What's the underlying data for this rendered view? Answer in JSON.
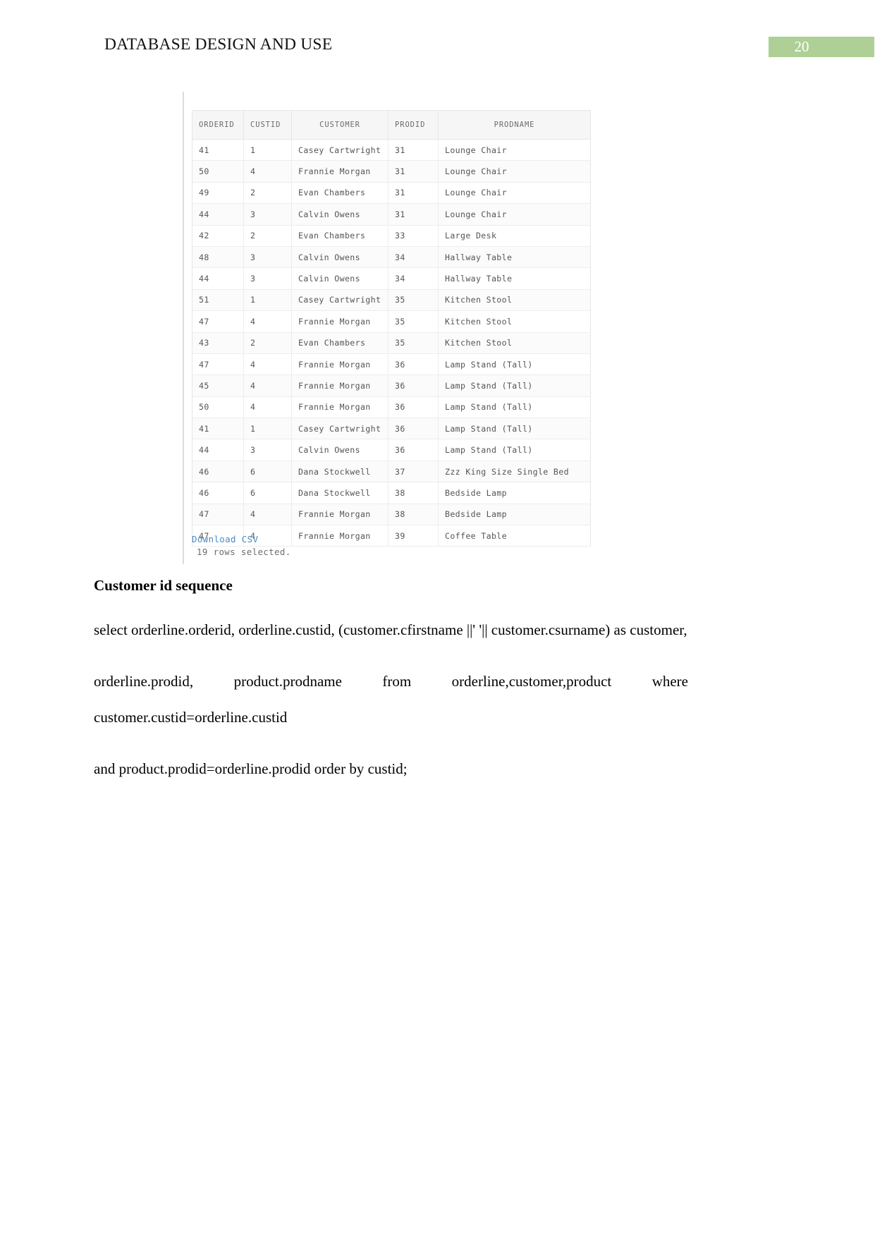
{
  "header": {
    "title": "DATABASE DESIGN AND USE",
    "page_number": "20",
    "badge_color": "#aed096"
  },
  "result_panel": {
    "link_color": "#4b89c4",
    "columns": [
      "ORDERID",
      "CUSTID",
      "CUSTOMER",
      "PRODID",
      "PRODNAME"
    ],
    "rows": [
      [
        "41",
        "1",
        "Casey Cartwright",
        "31",
        "Lounge Chair"
      ],
      [
        "50",
        "4",
        "Frannie Morgan",
        "31",
        "Lounge Chair"
      ],
      [
        "49",
        "2",
        "Evan Chambers",
        "31",
        "Lounge Chair"
      ],
      [
        "44",
        "3",
        "Calvin Owens",
        "31",
        "Lounge Chair"
      ],
      [
        "42",
        "2",
        "Evan Chambers",
        "33",
        "Large Desk"
      ],
      [
        "48",
        "3",
        "Calvin Owens",
        "34",
        "Hallway Table"
      ],
      [
        "44",
        "3",
        "Calvin Owens",
        "34",
        "Hallway Table"
      ],
      [
        "51",
        "1",
        "Casey Cartwright",
        "35",
        "Kitchen Stool"
      ],
      [
        "47",
        "4",
        "Frannie Morgan",
        "35",
        "Kitchen Stool"
      ],
      [
        "43",
        "2",
        "Evan Chambers",
        "35",
        "Kitchen Stool"
      ],
      [
        "47",
        "4",
        "Frannie Morgan",
        "36",
        "Lamp Stand (Tall)"
      ],
      [
        "45",
        "4",
        "Frannie Morgan",
        "36",
        "Lamp Stand (Tall)"
      ],
      [
        "50",
        "4",
        "Frannie Morgan",
        "36",
        "Lamp Stand (Tall)"
      ],
      [
        "41",
        "1",
        "Casey Cartwright",
        "36",
        "Lamp Stand (Tall)"
      ],
      [
        "44",
        "3",
        "Calvin Owens",
        "36",
        "Lamp Stand (Tall)"
      ],
      [
        "46",
        "6",
        "Dana Stockwell",
        "37",
        "Zzz King Size Single Bed"
      ],
      [
        "46",
        "6",
        "Dana Stockwell",
        "38",
        "Bedside Lamp"
      ],
      [
        "47",
        "4",
        "Frannie Morgan",
        "38",
        "Bedside Lamp"
      ],
      [
        "47",
        "4",
        "Frannie Morgan",
        "39",
        "Coffee Table"
      ]
    ],
    "download_link": "Download CSV",
    "rows_selected": "19 rows selected."
  },
  "content": {
    "heading": "Customer id sequence",
    "paragraph_1": "select  orderline.orderid,  orderline.custid,  (customer.cfirstname  ||' '||  customer.csurname)  as customer,",
    "paragraph_2": "orderline.prodid,        product.prodname        from        orderline,customer,product        where customer.custid=orderline.custid",
    "paragraph_3": "and product.prodid=orderline.prodid order by custid;"
  }
}
